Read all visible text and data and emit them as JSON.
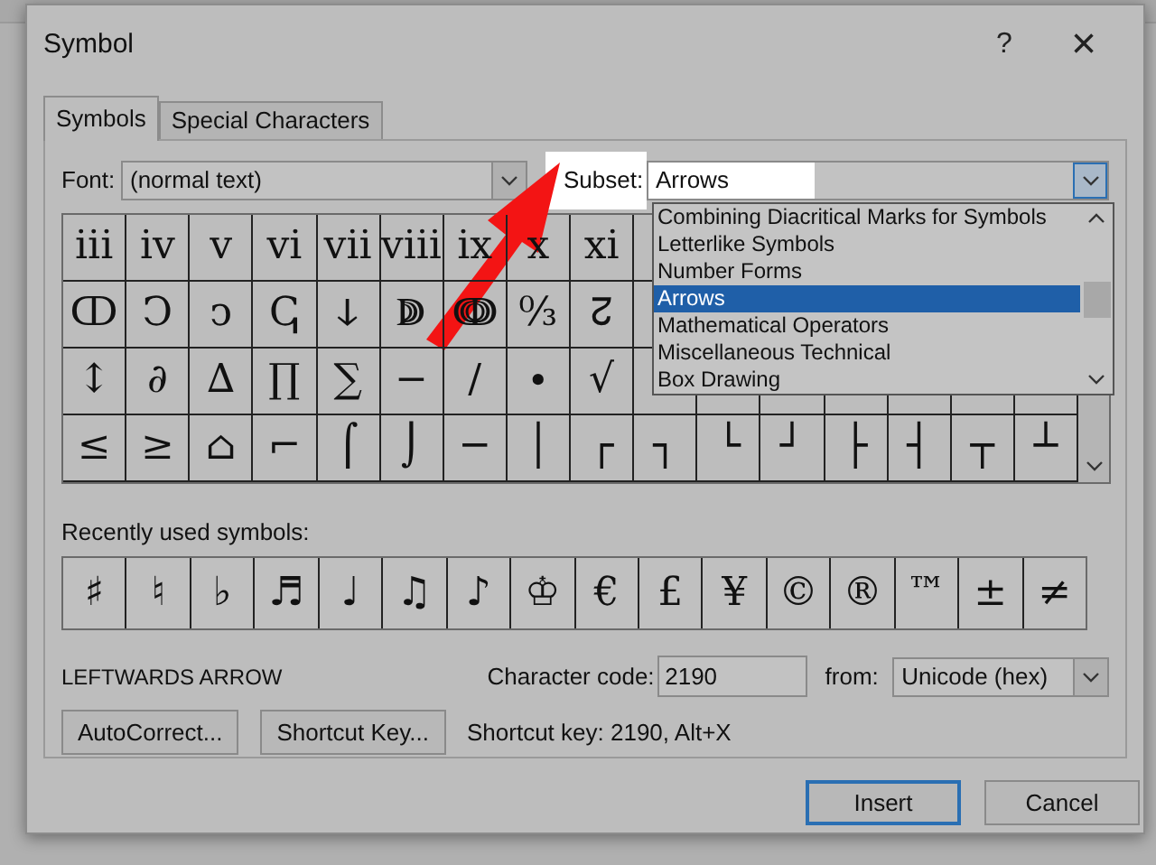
{
  "window": {
    "title": "Symbol",
    "help": "?",
    "close": "×"
  },
  "tabs": [
    {
      "label": "Symbols",
      "selected": true
    },
    {
      "label": "Special Characters",
      "selected": false
    }
  ],
  "font": {
    "label": "Font:",
    "value": "(normal text)"
  },
  "subset": {
    "label": "Subset:",
    "value": "Arrows",
    "expanded": true,
    "options": [
      {
        "label": "Combining Diacritical Marks for Symbols",
        "selected": false
      },
      {
        "label": "Letterlike Symbols",
        "selected": false
      },
      {
        "label": "Number Forms",
        "selected": false
      },
      {
        "label": "Arrows",
        "selected": true
      },
      {
        "label": "Mathematical Operators",
        "selected": false
      },
      {
        "label": "Miscellaneous Technical",
        "selected": false
      },
      {
        "label": "Box Drawing",
        "selected": false
      }
    ]
  },
  "symbol_grid": {
    "rows": [
      [
        "iii",
        "iv",
        "v",
        "vi",
        "vii",
        "viii",
        "ix",
        "x",
        "xi"
      ],
      [
        "ↀ",
        "Ↄ",
        "ↄ",
        "ↅ",
        "ↆ",
        "ↇ",
        "ↈ",
        "↉",
        "↊"
      ],
      [
        "↕",
        "∂",
        "∆",
        "∏",
        "∑",
        "−",
        "∕",
        "∙",
        "√"
      ],
      [
        "≤",
        "≥",
        "⌂",
        "⌐",
        "⌠",
        "⌡",
        "─",
        "│",
        "┌",
        "┐",
        "└",
        "┘",
        "├",
        "┤",
        "┬",
        "┴"
      ]
    ]
  },
  "recently_used": {
    "label": "Recently used symbols:",
    "symbols": [
      "♯",
      "♮",
      "♭",
      "♬",
      "♩",
      "♫",
      "♪",
      "♔",
      "€",
      "£",
      "¥",
      "©",
      "®",
      "™",
      "±",
      "≠"
    ]
  },
  "character_name": "LEFTWARDS ARROW",
  "character_code": {
    "label": "Character code:",
    "value": "2190"
  },
  "from": {
    "label": "from:",
    "value": "Unicode (hex)"
  },
  "buttons": [
    "AutoCorrect...",
    "Shortcut Key..."
  ],
  "shortcut_key": "Shortcut key: 2190, Alt+X",
  "footer_buttons": [
    {
      "label": "Insert",
      "default": true
    },
    {
      "label": "Cancel",
      "default": false
    }
  ]
}
